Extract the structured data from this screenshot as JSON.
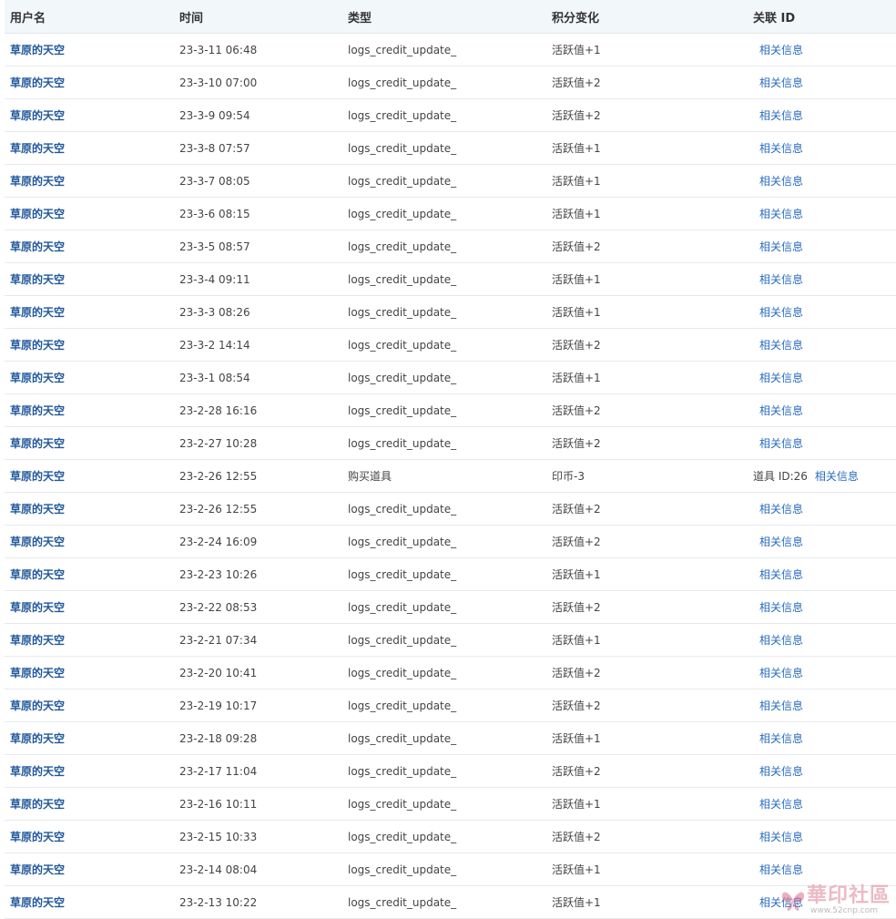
{
  "headers": {
    "user": "用户名",
    "time": "时间",
    "type": "类型",
    "credit": "积分变化",
    "relation": "关联 ID"
  },
  "rows": [
    {
      "user": "草原的天空",
      "time": "23-3-11 06:48",
      "type": "logs_credit_update_",
      "credit": "活跃值+1",
      "extra": "",
      "link": "相关信息"
    },
    {
      "user": "草原的天空",
      "time": "23-3-10 07:00",
      "type": "logs_credit_update_",
      "credit": "活跃值+2",
      "extra": "",
      "link": "相关信息"
    },
    {
      "user": "草原的天空",
      "time": "23-3-9 09:54",
      "type": "logs_credit_update_",
      "credit": "活跃值+2",
      "extra": "",
      "link": "相关信息"
    },
    {
      "user": "草原的天空",
      "time": "23-3-8 07:57",
      "type": "logs_credit_update_",
      "credit": "活跃值+1",
      "extra": "",
      "link": "相关信息"
    },
    {
      "user": "草原的天空",
      "time": "23-3-7 08:05",
      "type": "logs_credit_update_",
      "credit": "活跃值+1",
      "extra": "",
      "link": "相关信息"
    },
    {
      "user": "草原的天空",
      "time": "23-3-6 08:15",
      "type": "logs_credit_update_",
      "credit": "活跃值+1",
      "extra": "",
      "link": "相关信息"
    },
    {
      "user": "草原的天空",
      "time": "23-3-5 08:57",
      "type": "logs_credit_update_",
      "credit": "活跃值+2",
      "extra": "",
      "link": "相关信息"
    },
    {
      "user": "草原的天空",
      "time": "23-3-4 09:11",
      "type": "logs_credit_update_",
      "credit": "活跃值+1",
      "extra": "",
      "link": "相关信息"
    },
    {
      "user": "草原的天空",
      "time": "23-3-3 08:26",
      "type": "logs_credit_update_",
      "credit": "活跃值+1",
      "extra": "",
      "link": "相关信息"
    },
    {
      "user": "草原的天空",
      "time": "23-3-2 14:14",
      "type": "logs_credit_update_",
      "credit": "活跃值+2",
      "extra": "",
      "link": "相关信息"
    },
    {
      "user": "草原的天空",
      "time": "23-3-1 08:54",
      "type": "logs_credit_update_",
      "credit": "活跃值+1",
      "extra": "",
      "link": "相关信息"
    },
    {
      "user": "草原的天空",
      "time": "23-2-28 16:16",
      "type": "logs_credit_update_",
      "credit": "活跃值+2",
      "extra": "",
      "link": "相关信息"
    },
    {
      "user": "草原的天空",
      "time": "23-2-27 10:28",
      "type": "logs_credit_update_",
      "credit": "活跃值+2",
      "extra": "",
      "link": "相关信息"
    },
    {
      "user": "草原的天空",
      "time": "23-2-26 12:55",
      "type": "购买道具",
      "credit": "印币-3",
      "extra": "道具 ID:26",
      "link": "相关信息"
    },
    {
      "user": "草原的天空",
      "time": "23-2-26 12:55",
      "type": "logs_credit_update_",
      "credit": "活跃值+2",
      "extra": "",
      "link": "相关信息"
    },
    {
      "user": "草原的天空",
      "time": "23-2-24 16:09",
      "type": "logs_credit_update_",
      "credit": "活跃值+2",
      "extra": "",
      "link": "相关信息"
    },
    {
      "user": "草原的天空",
      "time": "23-2-23 10:26",
      "type": "logs_credit_update_",
      "credit": "活跃值+1",
      "extra": "",
      "link": "相关信息"
    },
    {
      "user": "草原的天空",
      "time": "23-2-22 08:53",
      "type": "logs_credit_update_",
      "credit": "活跃值+2",
      "extra": "",
      "link": "相关信息"
    },
    {
      "user": "草原的天空",
      "time": "23-2-21 07:34",
      "type": "logs_credit_update_",
      "credit": "活跃值+1",
      "extra": "",
      "link": "相关信息"
    },
    {
      "user": "草原的天空",
      "time": "23-2-20 10:41",
      "type": "logs_credit_update_",
      "credit": "活跃值+2",
      "extra": "",
      "link": "相关信息"
    },
    {
      "user": "草原的天空",
      "time": "23-2-19 10:17",
      "type": "logs_credit_update_",
      "credit": "活跃值+2",
      "extra": "",
      "link": "相关信息"
    },
    {
      "user": "草原的天空",
      "time": "23-2-18 09:28",
      "type": "logs_credit_update_",
      "credit": "活跃值+1",
      "extra": "",
      "link": "相关信息"
    },
    {
      "user": "草原的天空",
      "time": "23-2-17 11:04",
      "type": "logs_credit_update_",
      "credit": "活跃值+2",
      "extra": "",
      "link": "相关信息"
    },
    {
      "user": "草原的天空",
      "time": "23-2-16 10:11",
      "type": "logs_credit_update_",
      "credit": "活跃值+1",
      "extra": "",
      "link": "相关信息"
    },
    {
      "user": "草原的天空",
      "time": "23-2-15 10:33",
      "type": "logs_credit_update_",
      "credit": "活跃值+2",
      "extra": "",
      "link": "相关信息"
    },
    {
      "user": "草原的天空",
      "time": "23-2-14 08:04",
      "type": "logs_credit_update_",
      "credit": "活跃值+1",
      "extra": "",
      "link": "相关信息"
    },
    {
      "user": "草原的天空",
      "time": "23-2-13 10:22",
      "type": "logs_credit_update_",
      "credit": "活跃值+1",
      "extra": "",
      "link": "相关信息"
    }
  ],
  "watermark": {
    "text": "華印社區",
    "url": "www.52cnp.com"
  },
  "colors": {
    "user_link": "#20579c",
    "rel_link": "#2a6cbf",
    "header_bg": "#f2f7fa"
  }
}
